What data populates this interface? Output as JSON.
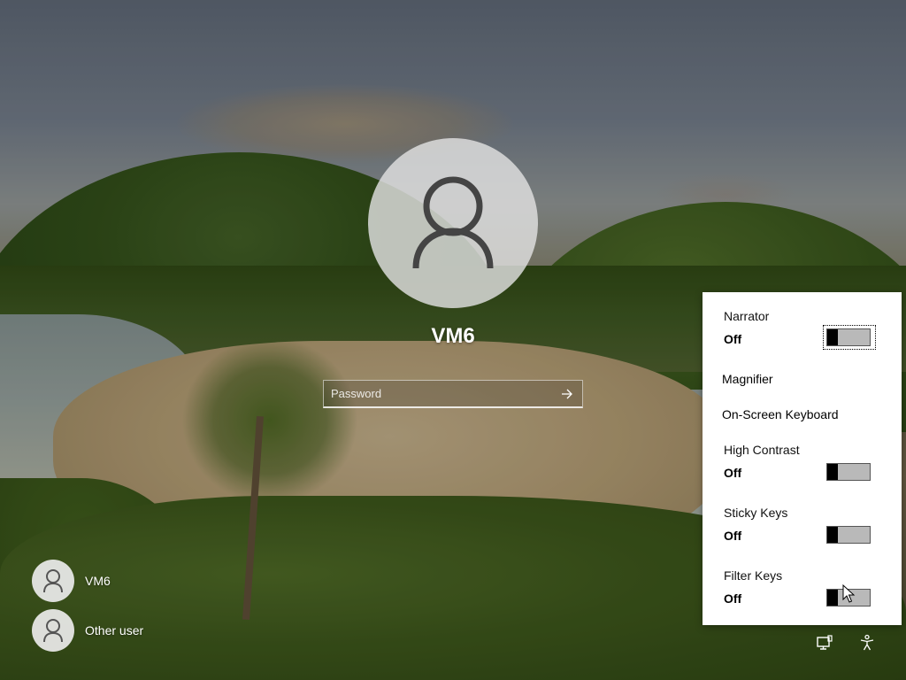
{
  "user": {
    "name": "VM6",
    "avatar_icon": "user-silhouette-icon"
  },
  "password": {
    "placeholder": "Password",
    "submit_icon": "arrow-right-icon"
  },
  "user_switcher": [
    {
      "label": "VM6",
      "icon": "user-icon"
    },
    {
      "label": "Other user",
      "icon": "user-icon"
    }
  ],
  "accessibility": {
    "narrator": {
      "title": "Narrator",
      "state": "Off"
    },
    "magnifier": {
      "title": "Magnifier"
    },
    "onscreen_keyboard": {
      "title": "On-Screen Keyboard"
    },
    "high_contrast": {
      "title": "High Contrast",
      "state": "Off"
    },
    "sticky_keys": {
      "title": "Sticky Keys",
      "state": "Off"
    },
    "filter_keys": {
      "title": "Filter Keys",
      "state": "Off"
    }
  },
  "system_icons": [
    "network-icon",
    "accessibility-icon"
  ],
  "colors": {
    "panel_bg": "#ffffff",
    "toggle_off": "#b9b9b9",
    "knob": "#000000"
  }
}
